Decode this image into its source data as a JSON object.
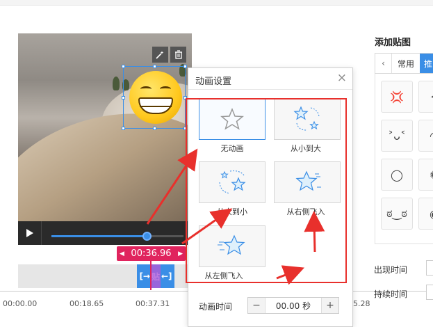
{
  "dialog": {
    "title": "动画设置",
    "close": "×",
    "options": [
      {
        "label": "无动画",
        "icon": "star-outline-icon",
        "selected": true
      },
      {
        "label": "从小到大",
        "icon": "star-grow-icon",
        "selected": false
      },
      {
        "label": "从大到小",
        "icon": "star-shrink-icon",
        "selected": false
      },
      {
        "label": "从右侧飞入",
        "icon": "star-fly-right-icon",
        "selected": false
      },
      {
        "label": "从左侧飞入",
        "icon": "star-fly-left-icon",
        "selected": false
      }
    ],
    "duration_label": "动画时间",
    "duration_value": "00.00 秒",
    "minus": "−",
    "plus": "+"
  },
  "player": {
    "current_time": "00:36.96",
    "progress": 0.72
  },
  "timeline": {
    "clip_label": "贴",
    "ticks": [
      "00:00.00",
      "00:18.65",
      "00:37.31"
    ],
    "partial_tick": "5.28"
  },
  "sticker_panel": {
    "title": "添加贴图",
    "tab_common": "常用",
    "tab_recommend": "推",
    "appear_label": "出现时间",
    "duration_label": "持续时间"
  },
  "colors": {
    "accent": "#3a8ee6",
    "highlight": "#e0245e",
    "annotation": "#e8302c"
  }
}
